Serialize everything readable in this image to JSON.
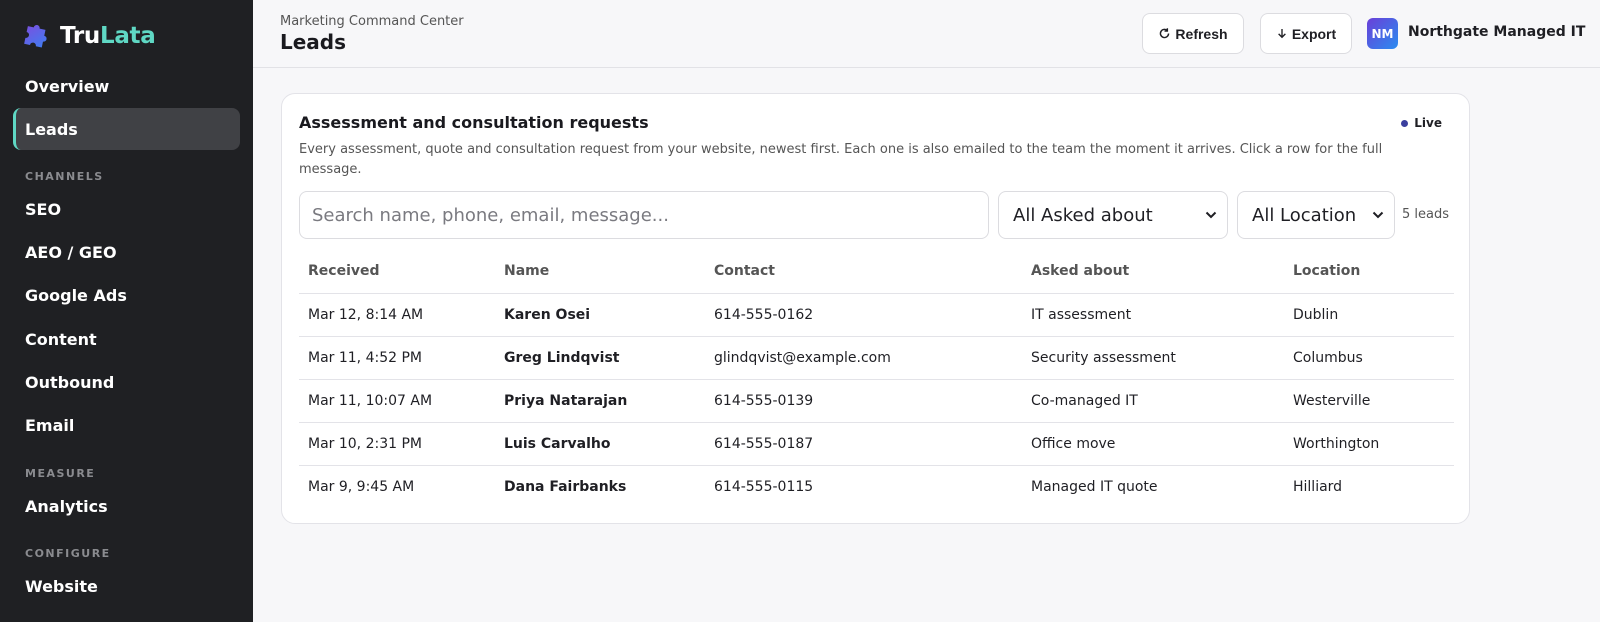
{
  "sidebar": {
    "logo": {
      "part1": "Tru",
      "part2": "Lata"
    },
    "items": {
      "overview": "Overview",
      "leads": "Leads",
      "seo": "SEO",
      "aeo": "AEO / GEO",
      "google_ads": "Google Ads",
      "content": "Content",
      "outbound": "Outbound",
      "email": "Email",
      "analytics": "Analytics",
      "website": "Website"
    },
    "sections": {
      "channels": "CHANNELS",
      "measure": "MEASURE",
      "configure": "CONFIGURE"
    }
  },
  "header": {
    "breadcrumb": "Marketing Command Center",
    "title": "Leads",
    "refresh_label": "Refresh",
    "export_label": "Export",
    "avatar_initials": "NM",
    "org_name": "Northgate Managed IT"
  },
  "card": {
    "title": "Assessment and consultation requests",
    "live_label": "Live",
    "description": "Every assessment, quote and consultation request from your website, newest first. Each one is also emailed to the team the moment it arrives. Click a row for the full message.",
    "search_placeholder": "Search name, phone, email, message...",
    "filter_asked": "All Asked about",
    "filter_location": "All Location",
    "lead_count": "5 leads"
  },
  "table": {
    "headers": {
      "received": "Received",
      "name": "Name",
      "contact": "Contact",
      "asked": "Asked about",
      "location": "Location"
    },
    "rows": [
      {
        "received": "Mar 12, 8:14 AM",
        "name": "Karen Osei",
        "contact": "614-555-0162",
        "asked": "IT assessment",
        "location": "Dublin"
      },
      {
        "received": "Mar 11, 4:52 PM",
        "name": "Greg Lindqvist",
        "contact": "glindqvist@example.com",
        "asked": "Security assessment",
        "location": "Columbus"
      },
      {
        "received": "Mar 11, 10:07 AM",
        "name": "Priya Natarajan",
        "contact": "614-555-0139",
        "asked": "Co-managed IT",
        "location": "Westerville"
      },
      {
        "received": "Mar 10, 2:31 PM",
        "name": "Luis Carvalho",
        "contact": "614-555-0187",
        "asked": "Office move",
        "location": "Worthington"
      },
      {
        "received": "Mar 9, 9:45 AM",
        "name": "Dana Fairbanks",
        "contact": "614-555-0115",
        "asked": "Managed IT quote",
        "location": "Hilliard"
      }
    ]
  },
  "colors": {
    "accent": "#5fd8c4",
    "sidebar_bg": "#1f2023",
    "live_dot": "#3a3f9e"
  },
  "icons": {
    "logo": "puzzle-logo-icon",
    "refresh": "refresh-icon",
    "export": "arrow-down-icon",
    "chevron": "chevron-down-icon",
    "live": "live-dot-icon"
  }
}
